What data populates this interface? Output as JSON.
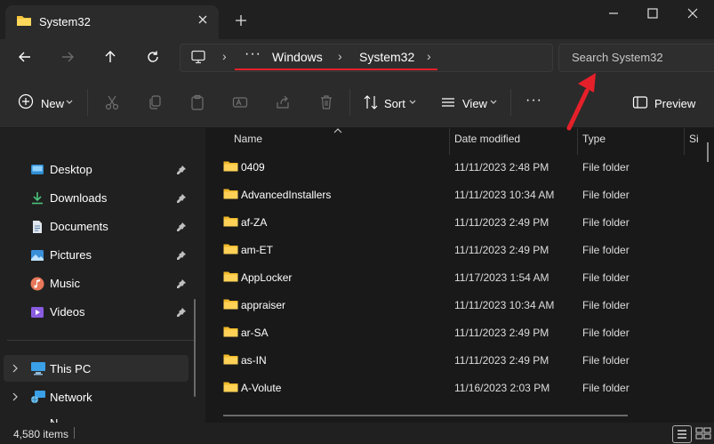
{
  "tab": {
    "title": "System32"
  },
  "address": {
    "ellipsis": "···",
    "crumbs": [
      "Windows",
      "System32"
    ],
    "separator": "›"
  },
  "search": {
    "placeholder": "Search System32"
  },
  "toolbar": {
    "new_label": "New",
    "sort_label": "Sort",
    "view_label": "View",
    "more_label": "···",
    "preview_label": "Preview"
  },
  "nav": {
    "quick_access": [
      {
        "label": "Desktop",
        "icon": "desktop-icon"
      },
      {
        "label": "Downloads",
        "icon": "download-icon"
      },
      {
        "label": "Documents",
        "icon": "document-icon"
      },
      {
        "label": "Pictures",
        "icon": "pictures-icon"
      },
      {
        "label": "Music",
        "icon": "music-icon"
      },
      {
        "label": "Videos",
        "icon": "videos-icon"
      }
    ],
    "this_pc": "This PC",
    "network": "Network",
    "partial": "N..."
  },
  "table": {
    "columns": [
      "Name",
      "Date modified",
      "Type",
      "Si"
    ],
    "rows": [
      {
        "name": "0409",
        "date": "11/11/2023 2:48 PM",
        "type": "File folder"
      },
      {
        "name": "AdvancedInstallers",
        "date": "11/11/2023 10:34 AM",
        "type": "File folder"
      },
      {
        "name": "af-ZA",
        "date": "11/11/2023 2:49 PM",
        "type": "File folder"
      },
      {
        "name": "am-ET",
        "date": "11/11/2023 2:49 PM",
        "type": "File folder"
      },
      {
        "name": "AppLocker",
        "date": "11/17/2023 1:54 AM",
        "type": "File folder"
      },
      {
        "name": "appraiser",
        "date": "11/11/2023 10:34 AM",
        "type": "File folder"
      },
      {
        "name": "ar-SA",
        "date": "11/11/2023 2:49 PM",
        "type": "File folder"
      },
      {
        "name": "as-IN",
        "date": "11/11/2023 2:49 PM",
        "type": "File folder"
      },
      {
        "name": "A-Volute",
        "date": "11/16/2023 2:03 PM",
        "type": "File folder"
      }
    ]
  },
  "status": {
    "items": "4,580 items"
  },
  "colors": {
    "background": "#202020",
    "folder": "#f5c33b",
    "annotation_red": "#e5202a",
    "accent_blue": "#4cc2ff"
  }
}
